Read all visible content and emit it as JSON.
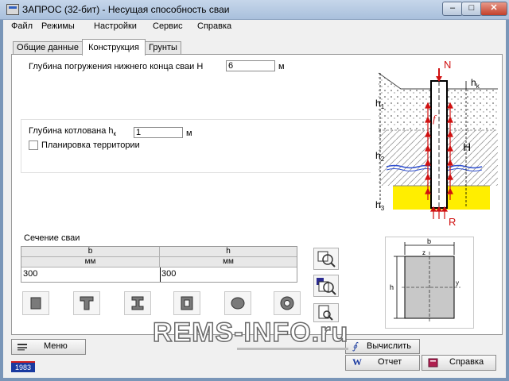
{
  "window": {
    "title": "ЗАПРОС (32-бит) - Несущая способность сваи",
    "min": "–",
    "max": "□",
    "close": "✕"
  },
  "menu": [
    "Файл",
    "Режимы",
    "Настройки",
    "Сервис",
    "Справка"
  ],
  "tabs": [
    "Общие данные",
    "Конструкция",
    "Грунты"
  ],
  "depth": {
    "label": "Глубина погружения нижнего конца сваи Н",
    "value": "6",
    "unit": "м"
  },
  "pit": {
    "label_main": "Глубина котлована h",
    "label_sub": "к",
    "value": "1",
    "unit": "м",
    "planning_label": "Планировка территории",
    "planning_checked": false
  },
  "section": {
    "label": "Сечение сваи",
    "col_b": "b",
    "col_h": "h",
    "unit_b": "мм",
    "unit_h": "мм",
    "b_value": "300",
    "h_value": "300"
  },
  "diagram": {
    "N": "N",
    "hk": "h",
    "hk_sub": "k",
    "h1": "h",
    "h1_sub": "1",
    "f": "f",
    "H": "H",
    "h2": "h",
    "h2_sub": "2",
    "h3": "h",
    "h3_sub": "3",
    "R": "R"
  },
  "section_preview": {
    "b": "b",
    "h": "h",
    "z": "z",
    "y": "y"
  },
  "buttons": {
    "menu": "Меню",
    "calculate": "Вычислить",
    "report": "Отчет",
    "help": "Справка"
  },
  "badge": "1983",
  "watermark": "REMS-INFO.ru"
}
